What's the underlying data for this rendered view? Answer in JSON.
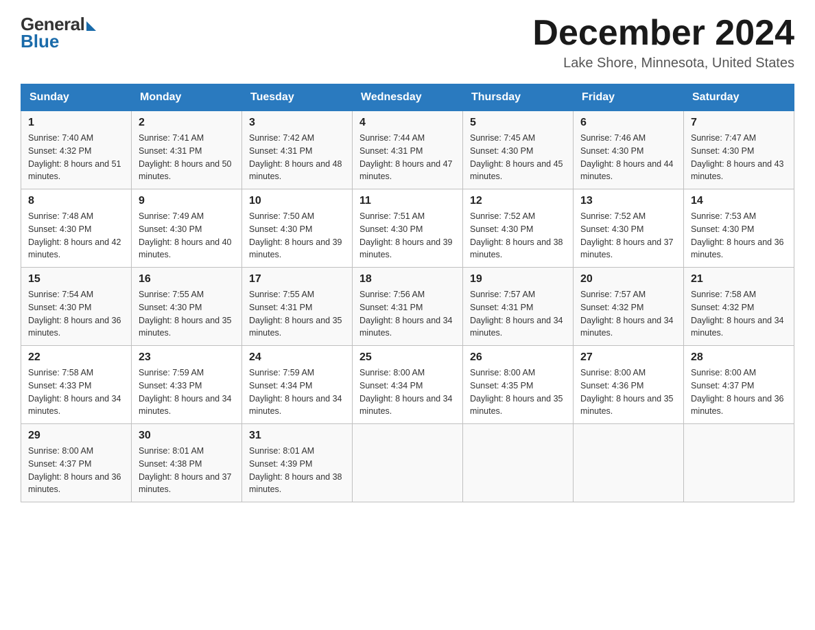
{
  "header": {
    "logo_general": "General",
    "logo_blue": "Blue",
    "main_title": "December 2024",
    "subtitle": "Lake Shore, Minnesota, United States"
  },
  "days_of_week": [
    "Sunday",
    "Monday",
    "Tuesday",
    "Wednesday",
    "Thursday",
    "Friday",
    "Saturday"
  ],
  "weeks": [
    [
      {
        "day": "1",
        "sunrise": "7:40 AM",
        "sunset": "4:32 PM",
        "daylight": "8 hours and 51 minutes."
      },
      {
        "day": "2",
        "sunrise": "7:41 AM",
        "sunset": "4:31 PM",
        "daylight": "8 hours and 50 minutes."
      },
      {
        "day": "3",
        "sunrise": "7:42 AM",
        "sunset": "4:31 PM",
        "daylight": "8 hours and 48 minutes."
      },
      {
        "day": "4",
        "sunrise": "7:44 AM",
        "sunset": "4:31 PM",
        "daylight": "8 hours and 47 minutes."
      },
      {
        "day": "5",
        "sunrise": "7:45 AM",
        "sunset": "4:30 PM",
        "daylight": "8 hours and 45 minutes."
      },
      {
        "day": "6",
        "sunrise": "7:46 AM",
        "sunset": "4:30 PM",
        "daylight": "8 hours and 44 minutes."
      },
      {
        "day": "7",
        "sunrise": "7:47 AM",
        "sunset": "4:30 PM",
        "daylight": "8 hours and 43 minutes."
      }
    ],
    [
      {
        "day": "8",
        "sunrise": "7:48 AM",
        "sunset": "4:30 PM",
        "daylight": "8 hours and 42 minutes."
      },
      {
        "day": "9",
        "sunrise": "7:49 AM",
        "sunset": "4:30 PM",
        "daylight": "8 hours and 40 minutes."
      },
      {
        "day": "10",
        "sunrise": "7:50 AM",
        "sunset": "4:30 PM",
        "daylight": "8 hours and 39 minutes."
      },
      {
        "day": "11",
        "sunrise": "7:51 AM",
        "sunset": "4:30 PM",
        "daylight": "8 hours and 39 minutes."
      },
      {
        "day": "12",
        "sunrise": "7:52 AM",
        "sunset": "4:30 PM",
        "daylight": "8 hours and 38 minutes."
      },
      {
        "day": "13",
        "sunrise": "7:52 AM",
        "sunset": "4:30 PM",
        "daylight": "8 hours and 37 minutes."
      },
      {
        "day": "14",
        "sunrise": "7:53 AM",
        "sunset": "4:30 PM",
        "daylight": "8 hours and 36 minutes."
      }
    ],
    [
      {
        "day": "15",
        "sunrise": "7:54 AM",
        "sunset": "4:30 PM",
        "daylight": "8 hours and 36 minutes."
      },
      {
        "day": "16",
        "sunrise": "7:55 AM",
        "sunset": "4:30 PM",
        "daylight": "8 hours and 35 minutes."
      },
      {
        "day": "17",
        "sunrise": "7:55 AM",
        "sunset": "4:31 PM",
        "daylight": "8 hours and 35 minutes."
      },
      {
        "day": "18",
        "sunrise": "7:56 AM",
        "sunset": "4:31 PM",
        "daylight": "8 hours and 34 minutes."
      },
      {
        "day": "19",
        "sunrise": "7:57 AM",
        "sunset": "4:31 PM",
        "daylight": "8 hours and 34 minutes."
      },
      {
        "day": "20",
        "sunrise": "7:57 AM",
        "sunset": "4:32 PM",
        "daylight": "8 hours and 34 minutes."
      },
      {
        "day": "21",
        "sunrise": "7:58 AM",
        "sunset": "4:32 PM",
        "daylight": "8 hours and 34 minutes."
      }
    ],
    [
      {
        "day": "22",
        "sunrise": "7:58 AM",
        "sunset": "4:33 PM",
        "daylight": "8 hours and 34 minutes."
      },
      {
        "day": "23",
        "sunrise": "7:59 AM",
        "sunset": "4:33 PM",
        "daylight": "8 hours and 34 minutes."
      },
      {
        "day": "24",
        "sunrise": "7:59 AM",
        "sunset": "4:34 PM",
        "daylight": "8 hours and 34 minutes."
      },
      {
        "day": "25",
        "sunrise": "8:00 AM",
        "sunset": "4:34 PM",
        "daylight": "8 hours and 34 minutes."
      },
      {
        "day": "26",
        "sunrise": "8:00 AM",
        "sunset": "4:35 PM",
        "daylight": "8 hours and 35 minutes."
      },
      {
        "day": "27",
        "sunrise": "8:00 AM",
        "sunset": "4:36 PM",
        "daylight": "8 hours and 35 minutes."
      },
      {
        "day": "28",
        "sunrise": "8:00 AM",
        "sunset": "4:37 PM",
        "daylight": "8 hours and 36 minutes."
      }
    ],
    [
      {
        "day": "29",
        "sunrise": "8:00 AM",
        "sunset": "4:37 PM",
        "daylight": "8 hours and 36 minutes."
      },
      {
        "day": "30",
        "sunrise": "8:01 AM",
        "sunset": "4:38 PM",
        "daylight": "8 hours and 37 minutes."
      },
      {
        "day": "31",
        "sunrise": "8:01 AM",
        "sunset": "4:39 PM",
        "daylight": "8 hours and 38 minutes."
      },
      null,
      null,
      null,
      null
    ]
  ]
}
